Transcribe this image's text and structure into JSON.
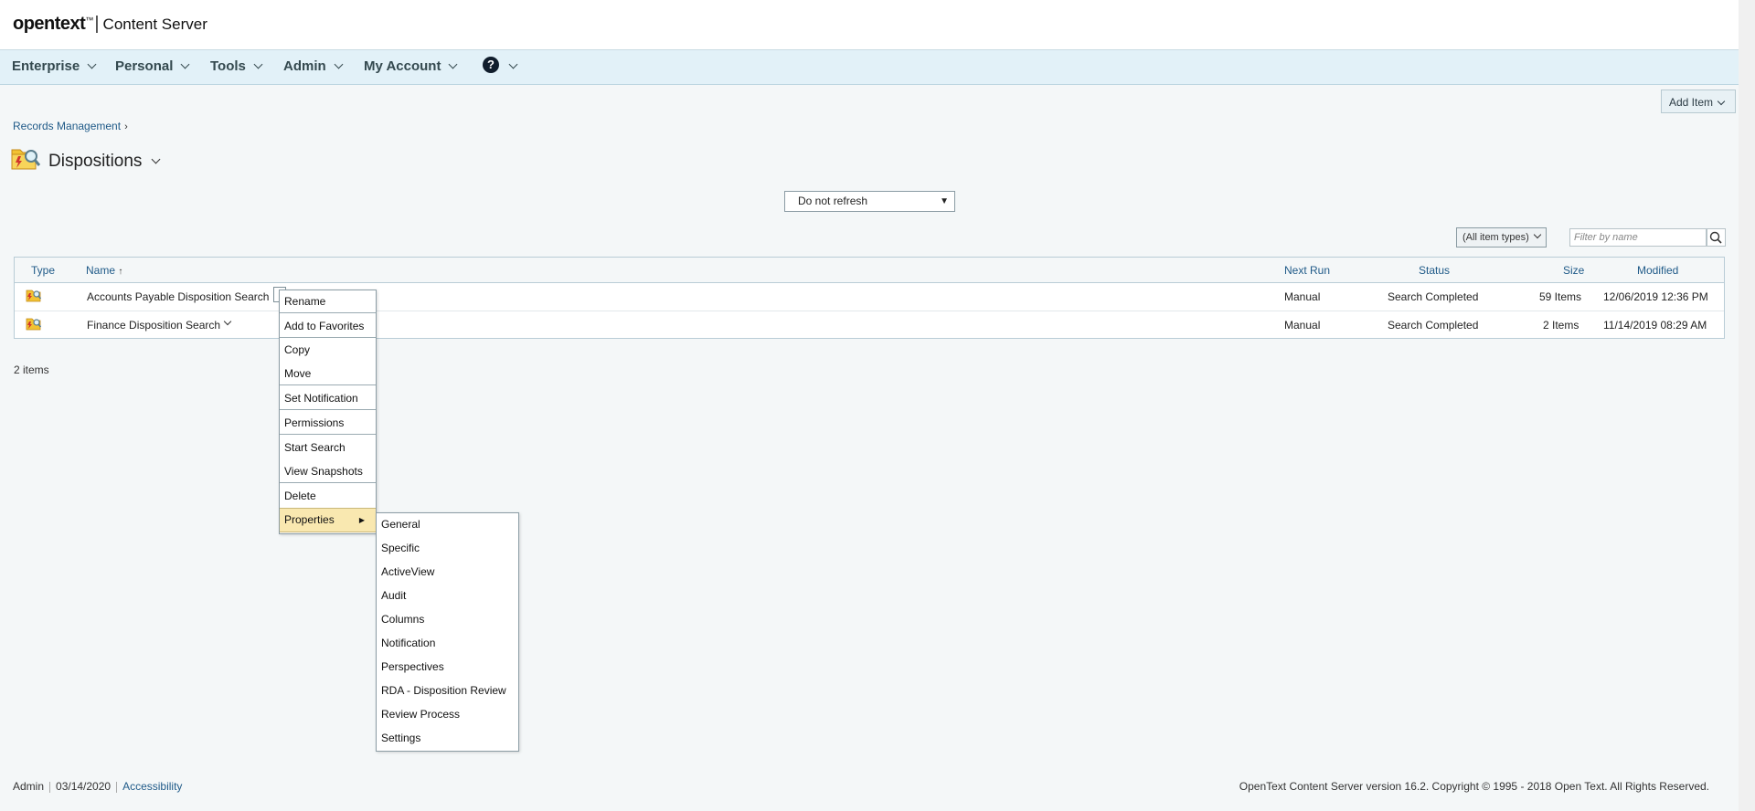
{
  "header": {
    "brand": "opentext",
    "tm": "™",
    "separator": "|",
    "product": "Content Server"
  },
  "nav": {
    "items": [
      {
        "label": "Enterprise"
      },
      {
        "label": "Personal"
      },
      {
        "label": "Tools"
      },
      {
        "label": "Admin"
      },
      {
        "label": "My Account"
      }
    ],
    "help_glyph": "?"
  },
  "toolbar": {
    "add_item_label": "Add Item"
  },
  "breadcrumb": {
    "items": [
      "Records Management"
    ],
    "separator": "›"
  },
  "page": {
    "title": "Dispositions",
    "icon": "disposition-folder-icon"
  },
  "refresh": {
    "selected": "Do not refresh"
  },
  "filter": {
    "type_selected": "(All item types)",
    "placeholder": "Filter by name"
  },
  "table": {
    "columns": {
      "type": "Type",
      "name": "Name",
      "next_run": "Next Run",
      "status": "Status",
      "size": "Size",
      "modified": "Modified"
    },
    "sort_indicator": "↑",
    "rows": [
      {
        "name": "Accounts Payable Disposition Search",
        "next_run": "Manual",
        "status": "Search Completed",
        "size": "59 Items",
        "modified": "12/06/2019 12:36 PM"
      },
      {
        "name": "Finance Disposition Search",
        "next_run": "Manual",
        "status": "Search Completed",
        "size": "2 Items",
        "modified": "11/14/2019 08:29 AM"
      }
    ]
  },
  "item_count": "2 items",
  "context_menu": {
    "items": [
      "Rename",
      "Add to Favorites",
      "Copy",
      "Move",
      "Set Notification",
      "Permissions",
      "Start Search",
      "View Snapshots",
      "Delete",
      "Properties"
    ],
    "submenu_arrow": "▶"
  },
  "properties_submenu": {
    "items": [
      "General",
      "Specific",
      "ActiveView",
      "Audit",
      "Columns",
      "Notification",
      "Perspectives",
      "RDA - Disposition Review",
      "Review Process",
      "Settings"
    ]
  },
  "footer": {
    "user": "Admin",
    "date": "03/14/2020",
    "accessibility": "Accessibility",
    "copyright": "OpenText Content Server version 16.2. Copyright © 1995 - 2018 Open Text. All Rights Reserved."
  },
  "colors": {
    "nav_bg": "#e2f1f8",
    "link": "#1f5a88",
    "menu_highlight": "#f9e8b0",
    "page_bg": "#f4f7f8"
  }
}
